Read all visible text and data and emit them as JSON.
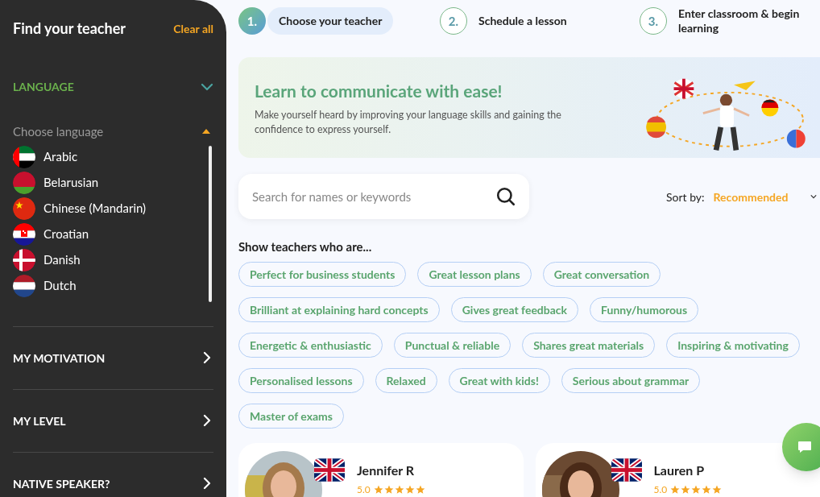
{
  "sidebar": {
    "title": "Find your teacher",
    "clear": "Clear all",
    "sections": [
      {
        "label": "LANGUAGE",
        "expanded": true
      },
      {
        "label": "MY MOTIVATION",
        "expanded": false
      },
      {
        "label": "MY LEVEL",
        "expanded": false
      },
      {
        "label": "NATIVE SPEAKER?",
        "expanded": false
      }
    ],
    "language_picker": {
      "placeholder": "Choose language",
      "open": true,
      "languages": [
        {
          "name": "Arabic",
          "kind": "uae"
        },
        {
          "name": "Belarusian",
          "kind": "belarus"
        },
        {
          "name": "Chinese (Mandarin)",
          "kind": "china"
        },
        {
          "name": "Croatian",
          "kind": "croatia"
        },
        {
          "name": "Danish",
          "kind": "denmark"
        },
        {
          "name": "Dutch",
          "kind": "netherlands"
        }
      ]
    }
  },
  "steps": [
    {
      "number": "1.",
      "label": "Choose your teacher",
      "selected": true
    },
    {
      "number": "2.",
      "label": "Schedule a lesson",
      "selected": false
    },
    {
      "number": "3.",
      "label": "Enter classroom & begin learning",
      "selected": false
    }
  ],
  "banner": {
    "title": "Learn to communicate with ease!",
    "text": "Make yourself heard by improving your language skills and gaining the confidence to express yourself."
  },
  "search": {
    "placeholder": "Search for names or keywords"
  },
  "sort": {
    "label": "Sort by:",
    "value": "Recommended"
  },
  "filters": {
    "title": "Show teachers who are...",
    "tags": [
      {
        "label": "Perfect for business students",
        "selected": false
      },
      {
        "label": "Great lesson plans",
        "selected": false
      },
      {
        "label": "Great conversation",
        "selected": false
      },
      {
        "label": "Brilliant at explaining hard concepts",
        "selected": false
      },
      {
        "label": "Gives great feedback",
        "selected": false
      },
      {
        "label": "Funny/humorous",
        "selected": false
      },
      {
        "label": "Energetic & enthusiastic",
        "selected": false
      },
      {
        "label": "Punctual & reliable",
        "selected": false
      },
      {
        "label": "Shares great materials",
        "selected": false
      },
      {
        "label": "Inspiring & motivating",
        "selected": false
      },
      {
        "label": "Personalised lessons",
        "selected": false
      },
      {
        "label": "Relaxed",
        "selected": false
      },
      {
        "label": "Great with kids!",
        "selected": false
      },
      {
        "label": "Serious about grammar",
        "selected": false
      },
      {
        "label": "Master of exams",
        "selected": false
      }
    ]
  },
  "teachers": [
    {
      "name": "Jennifer R",
      "rating": "5.0",
      "stars": 5
    },
    {
      "name": "Lauren P",
      "rating": "5.0",
      "stars": 5
    }
  ]
}
